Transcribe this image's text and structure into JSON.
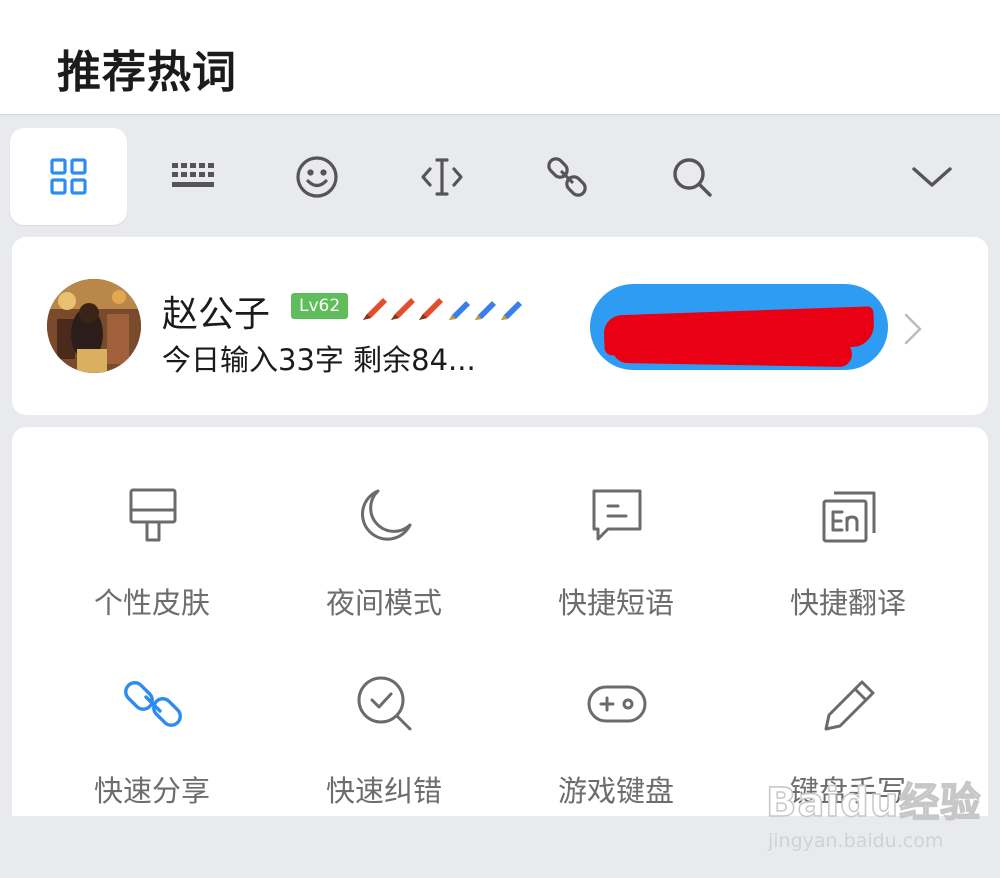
{
  "header": {
    "title": "推荐热词"
  },
  "toolbar": {
    "items": [
      {
        "name": "apps",
        "icon": "grid-icon",
        "active": true
      },
      {
        "name": "keyboard",
        "icon": "keyboard-icon",
        "active": false
      },
      {
        "name": "emoji",
        "icon": "smiley-icon",
        "active": false
      },
      {
        "name": "cursor",
        "icon": "cursor-move-icon",
        "active": false
      },
      {
        "name": "link",
        "icon": "link-icon",
        "active": false
      },
      {
        "name": "search",
        "icon": "search-icon",
        "active": false
      },
      {
        "name": "collapse",
        "icon": "chevron-down-icon",
        "active": false
      }
    ],
    "active_color": "#2d8cf0",
    "icon_color": "#555555"
  },
  "profile": {
    "username": "赵公子",
    "level": "Lv62",
    "today_stats": "今日输入33字  剩余84...",
    "promo_text": "",
    "level_color": "#5fbe5b",
    "promo_color": "#2f9cf3",
    "redaction_color": "#ea0014"
  },
  "features": [
    {
      "label": "个性皮肤",
      "icon": "paint-roller-icon"
    },
    {
      "label": "夜间模式",
      "icon": "moon-icon"
    },
    {
      "label": "快捷短语",
      "icon": "message-icon"
    },
    {
      "label": "快捷翻译",
      "icon": "translate-en-icon"
    },
    {
      "label": "快速分享",
      "icon": "share-link-icon"
    },
    {
      "label": "快速纠错",
      "icon": "check-search-icon"
    },
    {
      "label": "游戏键盘",
      "icon": "gamepad-icon"
    },
    {
      "label": "键盘手写",
      "icon": "pencil-icon"
    }
  ],
  "watermark": {
    "main": "Baidu经验",
    "sub": "jingyan.baidu.com"
  }
}
